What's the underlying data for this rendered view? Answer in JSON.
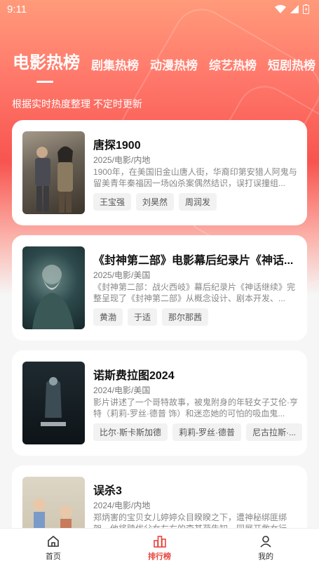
{
  "status": {
    "time": "9:11"
  },
  "tabs": [
    {
      "label": "电影热榜",
      "active": true
    },
    {
      "label": "剧集热榜"
    },
    {
      "label": "动漫热榜"
    },
    {
      "label": "综艺热榜"
    },
    {
      "label": "短剧热榜"
    }
  ],
  "subtitle": "根据实时热度整理 不定时更新",
  "items": [
    {
      "title": "唐探1900",
      "meta": "2025/电影/内地",
      "desc": "1900年，在美国旧金山唐人街，华裔印第安猎人阿鬼与留美青年秦福因一场凶杀案偶然结识，误打误撞组...",
      "tags": [
        "王宝强",
        "刘昊然",
        "周润发"
      ]
    },
    {
      "title": "《封神第二部》电影幕后纪录片《神话...",
      "meta": "2025/电影/美国",
      "desc": "《封神第二部：战火西岐》幕后纪录片《神话继续》完整呈现了《封神第二部》从概念设计、剧本开发、...",
      "tags": [
        "黄渤",
        "于适",
        "那尔那茜"
      ]
    },
    {
      "title": "诺斯费拉图2024",
      "meta": "2024/电影/美国",
      "desc": "影片讲述了一个哥特故事，被鬼附身的年轻女子艾伦·亨特（莉莉-罗丝·德普 饰）和迷恋她的可怕的吸血鬼...",
      "tags": [
        "比尔·斯卡斯加德",
        "莉莉-罗丝·德普",
        "尼古拉斯·..."
      ]
    },
    {
      "title": "误杀3",
      "meta": "2024/电影/内地",
      "desc": "郑炳害的宝贝女儿婷婷众目睽睽之下，遭神秘绑匪绑架，他将赎优父女左右的李其荷告知一同展开救女行动...",
      "tags": []
    }
  ],
  "nav": [
    {
      "label": "首页",
      "icon": "home-icon"
    },
    {
      "label": "排行榜",
      "icon": "ranking-icon",
      "active": true
    },
    {
      "label": "我的",
      "icon": "profile-icon"
    }
  ],
  "colors": {
    "accent": "#e8453c",
    "hero_top": "#ff9a7a",
    "hero_mid": "#f8544f"
  }
}
